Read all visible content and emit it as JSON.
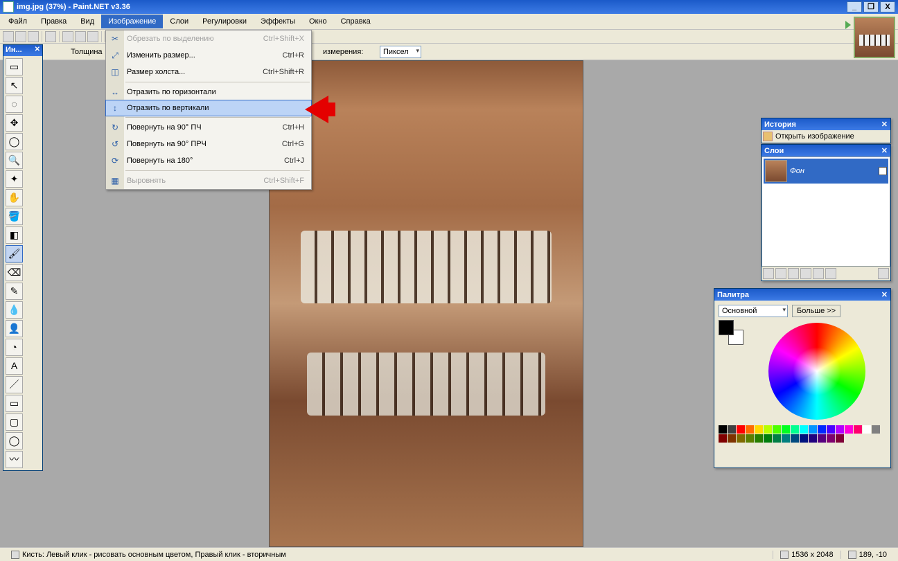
{
  "window": {
    "title": "img.jpg (37%) - Paint.NET v3.36"
  },
  "menubar": {
    "file": "Файл",
    "edit": "Правка",
    "view": "Вид",
    "image": "Изображение",
    "layers": "Слои",
    "adjustments": "Регулировки",
    "effects": "Эффекты",
    "window": "Окно",
    "help": "Справка"
  },
  "toolbar2": {
    "thickness": "Толщина",
    "measurement": "измерения:",
    "unit": "Пиксел"
  },
  "dropdown": {
    "crop": {
      "label": "Обрезать по выделению",
      "shortcut": "Ctrl+Shift+X",
      "icon": "✂"
    },
    "resize": {
      "label": "Изменить размер...",
      "shortcut": "Ctrl+R",
      "icon": "⤢"
    },
    "canvas": {
      "label": "Размер холста...",
      "shortcut": "Ctrl+Shift+R",
      "icon": "◫"
    },
    "fliph": {
      "label": "Отразить по горизонтали",
      "shortcut": "",
      "icon": "↔"
    },
    "flipv": {
      "label": "Отразить по вертикали",
      "shortcut": "",
      "icon": "↕"
    },
    "rotcw": {
      "label": "Повернуть на 90° ПЧ",
      "shortcut": "Ctrl+H",
      "icon": "↻"
    },
    "rotccw": {
      "label": "Повернуть на 90° ПРЧ",
      "shortcut": "Ctrl+G",
      "icon": "↺"
    },
    "rot180": {
      "label": "Повернуть на 180°",
      "shortcut": "Ctrl+J",
      "icon": "⟳"
    },
    "flatten": {
      "label": "Выровнять",
      "shortcut": "Ctrl+Shift+F",
      "icon": "▦"
    }
  },
  "tools_title": "Ин...",
  "history": {
    "title": "История",
    "entry": "Открыть изображение"
  },
  "layers": {
    "title": "Слои",
    "name": "Фон"
  },
  "palette": {
    "title": "Палитра",
    "mode": "Основной",
    "more": "Больше >>",
    "swatches": [
      "#000",
      "#404040",
      "#ff0000",
      "#ff6a00",
      "#ffd800",
      "#b6ff00",
      "#4cff00",
      "#00ff21",
      "#00ff90",
      "#00ffff",
      "#0094ff",
      "#0026ff",
      "#4800ff",
      "#b200ff",
      "#ff00dc",
      "#ff006e",
      "#fff",
      "#808080",
      "#7f0000",
      "#7f3300",
      "#7f6a00",
      "#5b7f00",
      "#267f00",
      "#007f0e",
      "#007f46",
      "#007f7f",
      "#004a7f",
      "#00137f",
      "#21007f",
      "#57007f",
      "#7f006e",
      "#7f0037"
    ]
  },
  "status": {
    "hint": "Кисть: Левый клик - рисовать основным цветом, Правый клик - вторичным",
    "dims": "1536 x 2048",
    "coords": "189, -10"
  }
}
